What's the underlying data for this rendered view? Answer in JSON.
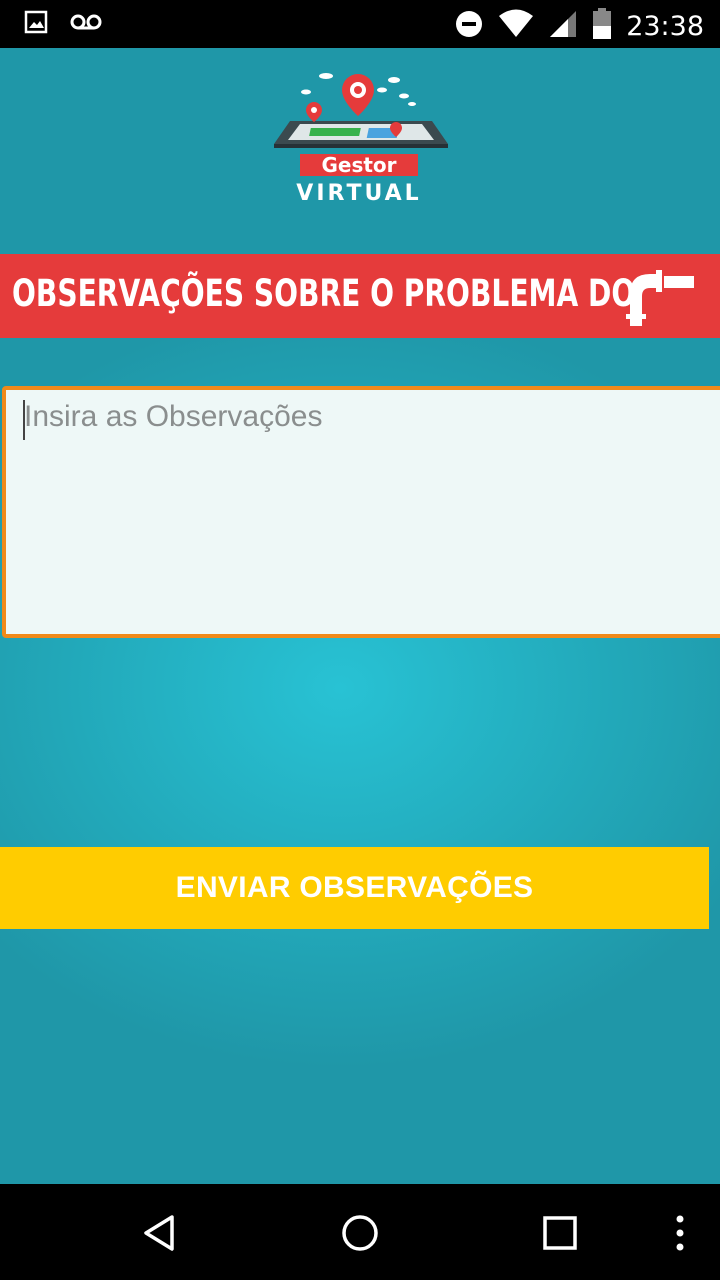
{
  "status_bar": {
    "time": "23:38",
    "left_icons": [
      "image-notification-icon",
      "voicemail-icon"
    ],
    "right_icons": [
      "do-not-disturb-icon",
      "wifi-icon",
      "signal-icon",
      "battery-icon"
    ]
  },
  "header": {
    "logo_line1": "Gestor",
    "logo_line2": "VIRTUAL"
  },
  "banner": {
    "title": "OBSERVAÇÕES SOBRE O PROBLEMA DO",
    "icon": "pipe-icon"
  },
  "form": {
    "observations_placeholder": "Insira as Observações",
    "observations_value": ""
  },
  "actions": {
    "send_label": "ENVIAR OBSERVAÇÕES"
  },
  "nav_bar": {
    "icons": [
      "back-icon",
      "home-icon",
      "recents-icon",
      "more-options-icon"
    ]
  },
  "colors": {
    "background_teal": "#22a8b9",
    "banner_red": "#e53b3b",
    "button_yellow": "#ffcc00",
    "input_border_orange": "#f08a1a"
  }
}
